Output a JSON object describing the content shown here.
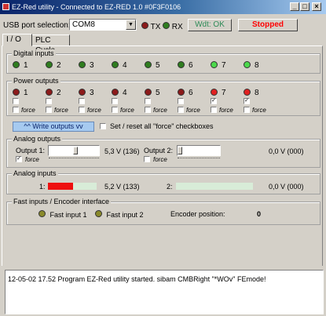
{
  "window": {
    "title": "EZ-Red utility - Connected to EZ-RED 1.0 #0F3F0106",
    "controls": [
      "_",
      "□",
      "×"
    ]
  },
  "toolbar": {
    "usb_label": "USB port selection:",
    "usb_value": "COM8",
    "tx_label": "TX",
    "rx_label": "RX",
    "wdt_label": "Wdt: OK",
    "stopped_label": "Stopped",
    "stopped_color": "#ff0000",
    "wdt_color": "#2e8b57"
  },
  "tabs": [
    {
      "label": "I / O",
      "active": true
    },
    {
      "label": "PLC Cycle",
      "active": false
    }
  ],
  "digital_inputs": {
    "title": "Digital inputs",
    "items": [
      {
        "label": "1",
        "state": "on"
      },
      {
        "label": "2",
        "state": "on"
      },
      {
        "label": "3",
        "state": "on"
      },
      {
        "label": "4",
        "state": "on"
      },
      {
        "label": "5",
        "state": "on"
      },
      {
        "label": "6",
        "state": "on"
      },
      {
        "label": "7",
        "state": "bright"
      },
      {
        "label": "8",
        "state": "bright"
      }
    ]
  },
  "power_outputs": {
    "title": "Power outputs",
    "force_label": "force",
    "items": [
      {
        "label": "1",
        "checked": false
      },
      {
        "label": "2",
        "checked": false
      },
      {
        "label": "3",
        "checked": false
      },
      {
        "label": "4",
        "checked": false
      },
      {
        "label": "5",
        "checked": false
      },
      {
        "label": "6",
        "checked": false
      },
      {
        "label": "7",
        "checked": true
      },
      {
        "label": "8",
        "checked": true
      }
    ]
  },
  "write_outputs": {
    "button_label": "^^  Write outputs  vv",
    "set_reset_label": "Set / reset all \"force\" checkboxes"
  },
  "analog_outputs": {
    "title": "Analog outputs",
    "output1_label": "Output 1:",
    "output1_value": "5,3 V (136)",
    "output1_level": 0.53,
    "output1_force_checked": true,
    "output2_label": "Output 2:",
    "output2_value": "0,0 V (000)",
    "output2_level": 0.0,
    "output2_force_checked": false,
    "force_label": "force"
  },
  "analog_inputs": {
    "title": "Analog inputs",
    "input1_label": "1:",
    "input1_value": "5,2 V (133)",
    "input1_level": 0.52,
    "input2_label": "2:",
    "input2_value": "0,0 V (000)",
    "input2_level": 0.0
  },
  "fast_inputs": {
    "title": "Fast inputs / Encoder interface",
    "fast1_label": "Fast input 1",
    "fast2_label": "Fast input 2",
    "encoder_label": "Encoder position:",
    "encoder_value": "0"
  },
  "log": {
    "line": "12-05-02 17.52  Program EZ-Red utility started. sibam CMBRight \"*WOv\" FEmode!"
  }
}
